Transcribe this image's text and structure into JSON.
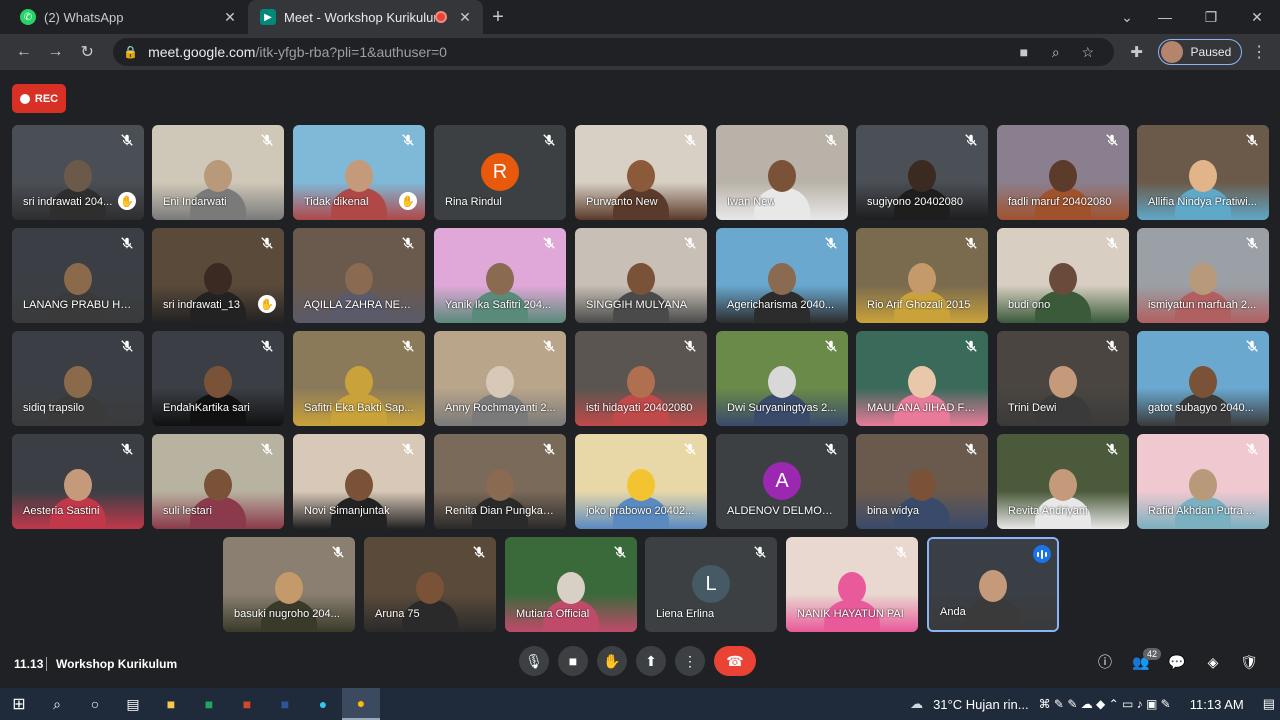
{
  "browser": {
    "tabs": [
      {
        "title": "(2) WhatsApp",
        "active": false
      },
      {
        "title": "Meet - Workshop Kurikulum",
        "active": true
      }
    ],
    "url_host": "meet.google.com",
    "url_path": "/itk-yfgb-rba?pli=1&authuser=0",
    "profile_label": "Paused"
  },
  "meet": {
    "rec_label": "REC",
    "time": "11.13",
    "meeting_title": "Workshop Kurikulum",
    "participant_count": "42"
  },
  "participants": [
    {
      "name": "sri indrawati 204...",
      "hand": true
    },
    {
      "name": "Eni Indarwati"
    },
    {
      "name": "Tidak dikenal",
      "hand": true
    },
    {
      "name": "Rina Rindul",
      "initial": "R",
      "color": "#e8590c"
    },
    {
      "name": "Purwanto New"
    },
    {
      "name": "Iwan New"
    },
    {
      "name": "sugiyono 20402080"
    },
    {
      "name": "fadli maruf 20402080"
    },
    {
      "name": "Allifia Nindya Pratiwi..."
    },
    {
      "name": "LANANG PRABU HA..."
    },
    {
      "name": "sri indrawati_13",
      "hand": true
    },
    {
      "name": "AQILLA ZAHRA NEO..."
    },
    {
      "name": "Yanik Ika Safitri 204..."
    },
    {
      "name": "SINGGIH MULYANA"
    },
    {
      "name": "Agericharisma 2040..."
    },
    {
      "name": "Rio Arif Ghozali 2015"
    },
    {
      "name": "budi ono"
    },
    {
      "name": "ismiyatun marfuah 2..."
    },
    {
      "name": "sidiq trapsilo"
    },
    {
      "name": "EndahKartika sari"
    },
    {
      "name": "Safitri Eka Bakti Sap..."
    },
    {
      "name": "Anny Rochmayanti 2..."
    },
    {
      "name": "isti hidayati 20402080"
    },
    {
      "name": "Dwi Suryaningtyas 2..."
    },
    {
      "name": "MAULANA JIHAD FE..."
    },
    {
      "name": "Trini Dewi"
    },
    {
      "name": "gatot subagyo 2040..."
    },
    {
      "name": "Aesteria Sastini"
    },
    {
      "name": "suli lestari"
    },
    {
      "name": "Novi Simanjuntak"
    },
    {
      "name": "Renita Dian Pungkas..."
    },
    {
      "name": "joko prabowo 20402..."
    },
    {
      "name": "ALDENOV DELMORA ...",
      "initial": "A",
      "color": "#9c27b0"
    },
    {
      "name": "bina widya"
    },
    {
      "name": "Revita Andriyani"
    },
    {
      "name": "Rafid Akhdan Putra ..."
    },
    {
      "name": "basuki nugroho 204..."
    },
    {
      "name": "Aruna 75"
    },
    {
      "name": "Mutiara Official"
    },
    {
      "name": "Liena Erlina",
      "initial": "L",
      "color": "#455a64"
    },
    {
      "name": "NANIK HAYATUN PAI"
    },
    {
      "name": "Anda",
      "self": true
    }
  ],
  "taskbar": {
    "weather": "31°C  Hujan rin...",
    "clock": "11:13 AM"
  }
}
